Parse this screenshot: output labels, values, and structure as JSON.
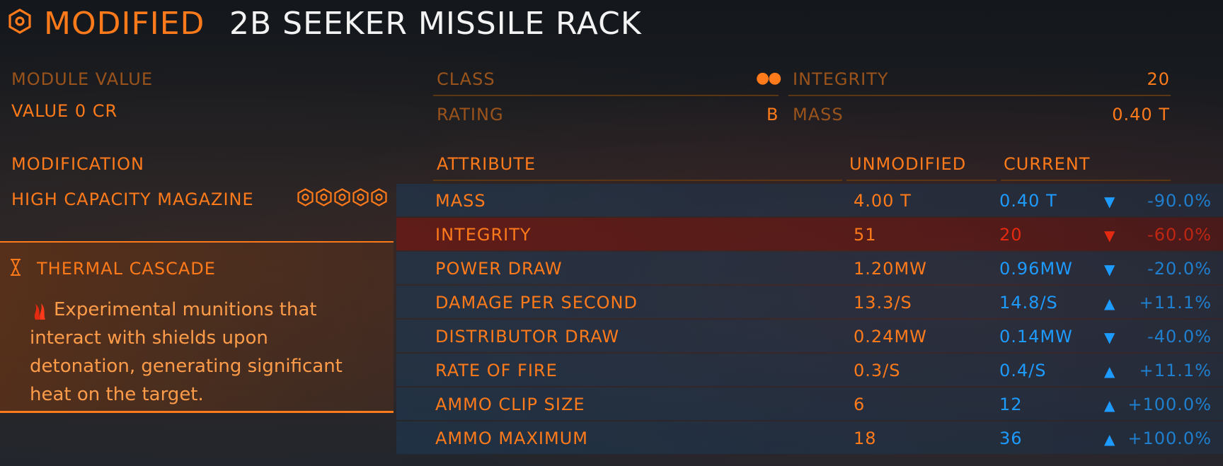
{
  "header": {
    "status": "MODIFIED",
    "title": "2B SEEKER MISSILE RACK"
  },
  "module_value": {
    "label": "MODULE VALUE",
    "value": "VALUE 0 CR"
  },
  "info": {
    "class_label": "CLASS",
    "class_value": "●●",
    "rating_label": "RATING",
    "rating_value": "B",
    "integrity_label": "INTEGRITY",
    "integrity_value": "20",
    "mass_label": "MASS",
    "mass_value": "0.40 T"
  },
  "modification": {
    "label": "MODIFICATION",
    "value": "HIGH CAPACITY MAGAZINE",
    "grade": 5
  },
  "experimental": {
    "title": "THERMAL CASCADE",
    "description": "Experimental munitions that interact with shields upon detonation, generating significant heat on the target."
  },
  "table": {
    "headers": {
      "attribute": "ATTRIBUTE",
      "unmodified": "UNMODIFIED",
      "current": "CURRENT"
    },
    "rows": [
      {
        "attribute": "MASS",
        "unmodified": "4.00 T",
        "current": "0.40 T",
        "direction": "down",
        "change": "-90.0%",
        "good": true
      },
      {
        "attribute": "INTEGRITY",
        "unmodified": "51",
        "current": "20",
        "direction": "down",
        "change": "-60.0%",
        "good": false
      },
      {
        "attribute": "POWER DRAW",
        "unmodified": "1.20MW",
        "current": "0.96MW",
        "direction": "down",
        "change": "-20.0%",
        "good": true
      },
      {
        "attribute": "DAMAGE PER SECOND",
        "unmodified": "13.3/S",
        "current": "14.8/S",
        "direction": "up",
        "change": "+11.1%",
        "good": true
      },
      {
        "attribute": "DISTRIBUTOR DRAW",
        "unmodified": "0.24MW",
        "current": "0.14MW",
        "direction": "down",
        "change": "-40.0%",
        "good": true
      },
      {
        "attribute": "RATE OF FIRE",
        "unmodified": "0.3/S",
        "current": "0.4/S",
        "direction": "up",
        "change": "+11.1%",
        "good": true
      },
      {
        "attribute": "AMMO CLIP SIZE",
        "unmodified": "6",
        "current": "12",
        "direction": "up",
        "change": "+100.0%",
        "good": true
      },
      {
        "attribute": "AMMO MAXIMUM",
        "unmodified": "18",
        "current": "36",
        "direction": "up",
        "change": "+100.0%",
        "good": true
      }
    ]
  },
  "colors": {
    "accent": "#ff7a1a",
    "good": "#1e9bff",
    "bad": "#e42a10",
    "title": "#f1f1f1"
  }
}
